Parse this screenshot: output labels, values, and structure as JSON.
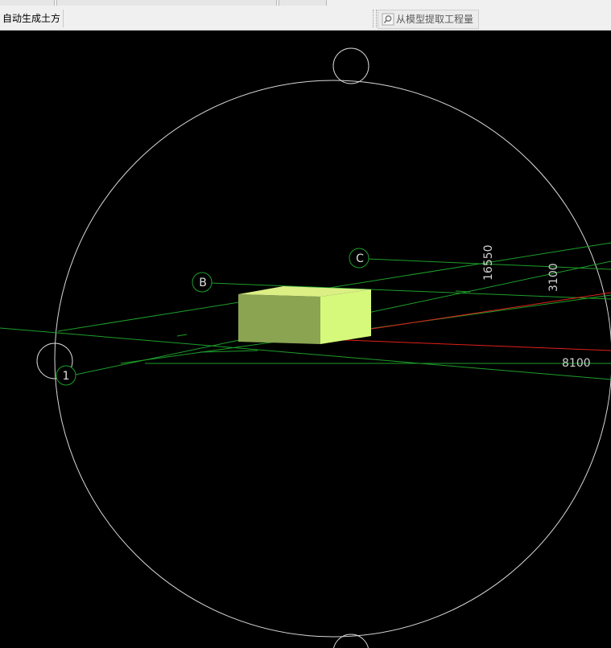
{
  "toolbar": {
    "auto_earthwork_label": "自动生成土方",
    "extract_quantity_label": "从模型提取工程量",
    "extract_icon": "search-icon"
  },
  "viewport": {
    "axis_labels": {
      "axis_1": "1",
      "axis_B": "B",
      "axis_C": "C"
    },
    "dimensions": {
      "dim_16550": "16550",
      "dim_3100": "3100",
      "dim_8100": "8100"
    },
    "colors": {
      "background": "#000000",
      "grid_line": "#1e9e2a",
      "highlight_line": "#e0201a",
      "orbit_circle": "#d8d8d8",
      "box_front": "#8aa452",
      "box_top": "#dcef85",
      "box_right": "#d6f97c"
    }
  }
}
